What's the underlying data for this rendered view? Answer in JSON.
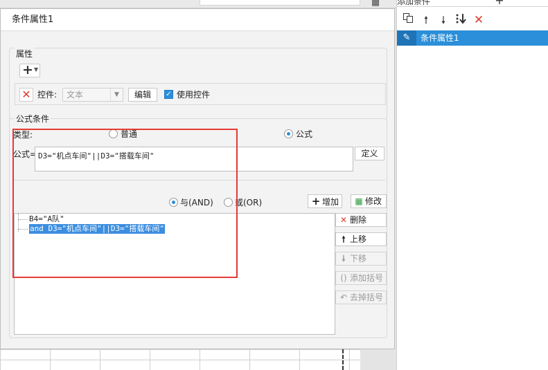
{
  "right_panel": {
    "tab_add": "添加条件",
    "tab_plus": "+",
    "toolbar": {
      "copy_icon": "copy-icon",
      "up_icon": "arrow-up-icon",
      "down_icon": "arrow-down-icon",
      "sort_icon": "sort-down-icon",
      "delete_icon": "delete-x-icon"
    },
    "items": [
      {
        "label": "条件属性1",
        "icon": "pencil-icon"
      }
    ]
  },
  "dialog": {
    "title": "条件属性1",
    "properties": {
      "legend": "属性",
      "add_button": "+",
      "control_label": "控件:",
      "control_select_value": "文本",
      "edit_button": "编辑",
      "use_control_label": "使用控件",
      "use_control_checked": true
    },
    "formula": {
      "legend": "公式条件",
      "type_label": "类型:",
      "radio_normal": "普通",
      "radio_formula": "公式",
      "selected_type": "公式",
      "formula_label": "公式=",
      "formula_value": "D3=\"机点车间\"||D3=\"搭载车间\"",
      "define_button": "定义",
      "radio_and": "与(AND)",
      "radio_or": "或(OR)",
      "selected_logic": "与(AND)",
      "add_button": "增加",
      "modify_button": "修改",
      "conditions": [
        "B4=\"A队\"",
        "and D3=\"机点车间\"||D3=\"搭载车间\""
      ],
      "selected_condition_index": 1,
      "buttons": {
        "delete": "删除",
        "move_up": "上移",
        "move_down": "下移",
        "add_paren": "添加括号",
        "remove_paren": "去掉括号"
      }
    }
  },
  "colors": {
    "accent": "#2b8fd9",
    "selection": "#3b8ee0",
    "annotation": "#e53935",
    "delete_red": "#e03c31",
    "modify_green": "#2e9b3a"
  }
}
